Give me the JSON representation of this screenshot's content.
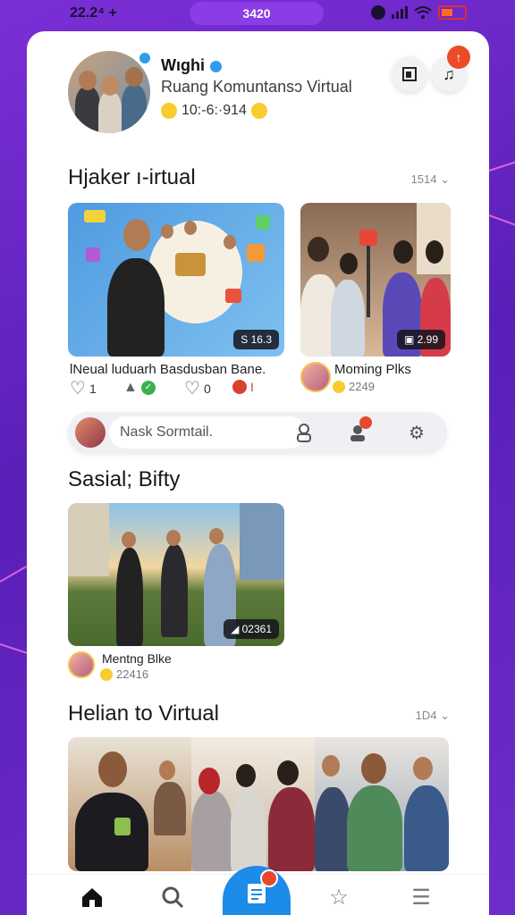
{
  "status_bar": {
    "time": "22.2⁴ +",
    "center_pill": "3420",
    "icons": [
      "camera-icon",
      "signal-icon",
      "wifi-icon",
      "battery-icon"
    ],
    "battery_color": "#ff6a2a"
  },
  "profile": {
    "name": "Wıghi",
    "subtitle": "Ruang Komuntansɔ Virtual",
    "meta": "10:-6:·914",
    "action_icons": [
      "book-icon",
      "music-note-icon"
    ],
    "notification_badge": "↑"
  },
  "section1": {
    "title": "Hjaker ı-irtual",
    "count": "1514",
    "posts": [
      {
        "caption": "lNeual luduarh Basdusban Bane.",
        "badge": "S 16.3",
        "reactions": [
          "1",
          "",
          "0",
          "I"
        ]
      },
      {
        "caption": "Moming Plks",
        "badge": "2.99",
        "meta": "2249"
      }
    ]
  },
  "search": {
    "placeholder": "Nask Sormtail.",
    "icons": [
      "contact-icon",
      "user-alert-icon",
      "gear-icon"
    ]
  },
  "section2": {
    "title": "Sasial; Bifty",
    "post": {
      "badge": "02361",
      "caption": "Mentng Blke",
      "meta": "22416"
    }
  },
  "section3": {
    "title": "Helian to Virtual",
    "count": "1D4"
  },
  "nav": {
    "items": [
      "home-icon",
      "search-icon",
      "compose-icon",
      "star-icon",
      "menu-icon"
    ]
  },
  "colors": {
    "background": "#6a28c8",
    "accent": "#1d8be8",
    "alert": "#e8472b"
  }
}
